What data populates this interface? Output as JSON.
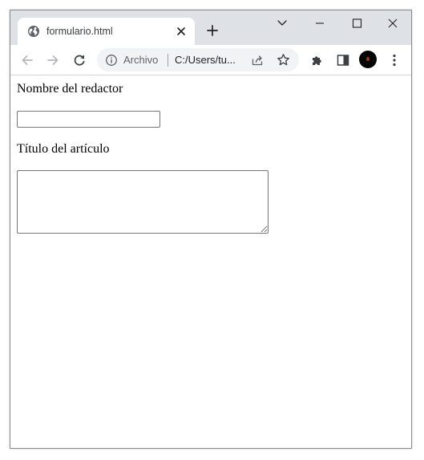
{
  "browser": {
    "tab": {
      "title": "formulario.html",
      "favicon": "globe-icon"
    },
    "omnibox": {
      "scheme_label": "Archivo",
      "url": "C:/Users/tu..."
    }
  },
  "form": {
    "name_label": "Nombre del redactor",
    "name_value": "",
    "title_label": "Título del artículo",
    "title_value": ""
  },
  "colors": {
    "tabstrip_bg": "#dee1e6",
    "omnibox_bg": "#f1f3f4",
    "icon_color": "#5f6368",
    "page_bg": "#ffffff"
  }
}
